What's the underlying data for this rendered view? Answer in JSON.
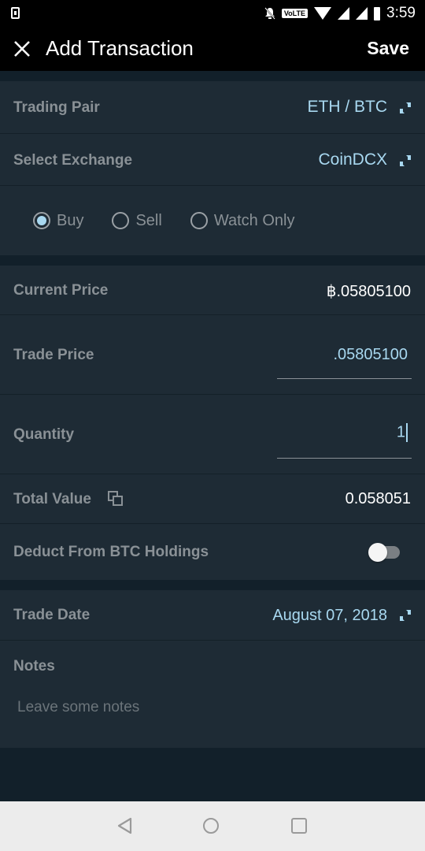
{
  "status_bar": {
    "time": "3:59",
    "network_badge": "VoLTE",
    "icons": [
      "download-icon",
      "notifications-off-icon",
      "volte-icon",
      "wifi-icon",
      "signal-icon",
      "signal-icon",
      "battery-icon"
    ]
  },
  "app_bar": {
    "title": "Add Transaction",
    "save_label": "Save",
    "close_icon": "close-icon"
  },
  "form": {
    "trading_pair": {
      "label": "Trading Pair",
      "value": "ETH / BTC"
    },
    "exchange": {
      "label": "Select Exchange",
      "value": "CoinDCX"
    },
    "type_options": [
      {
        "label": "Buy",
        "selected": true
      },
      {
        "label": "Sell",
        "selected": false
      },
      {
        "label": "Watch Only",
        "selected": false
      }
    ],
    "current_price": {
      "label": "Current Price",
      "value": "฿.05805100"
    },
    "trade_price": {
      "label": "Trade Price",
      "value": ".05805100"
    },
    "quantity": {
      "label": "Quantity",
      "value": "1"
    },
    "total_value": {
      "label": "Total Value",
      "value": "0.058051"
    },
    "deduct": {
      "label": "Deduct From BTC Holdings",
      "enabled": false
    },
    "trade_date": {
      "label": "Trade Date",
      "value": "August 07, 2018"
    },
    "notes": {
      "label": "Notes",
      "placeholder": "Leave some notes"
    }
  },
  "colors": {
    "accent": "#a8d8f0",
    "row_bg": "#1e2b35",
    "page_bg": "#12202a",
    "label": "#8a9196"
  },
  "nav_bar": {
    "buttons": [
      "back-icon",
      "home-icon",
      "recents-icon"
    ]
  }
}
